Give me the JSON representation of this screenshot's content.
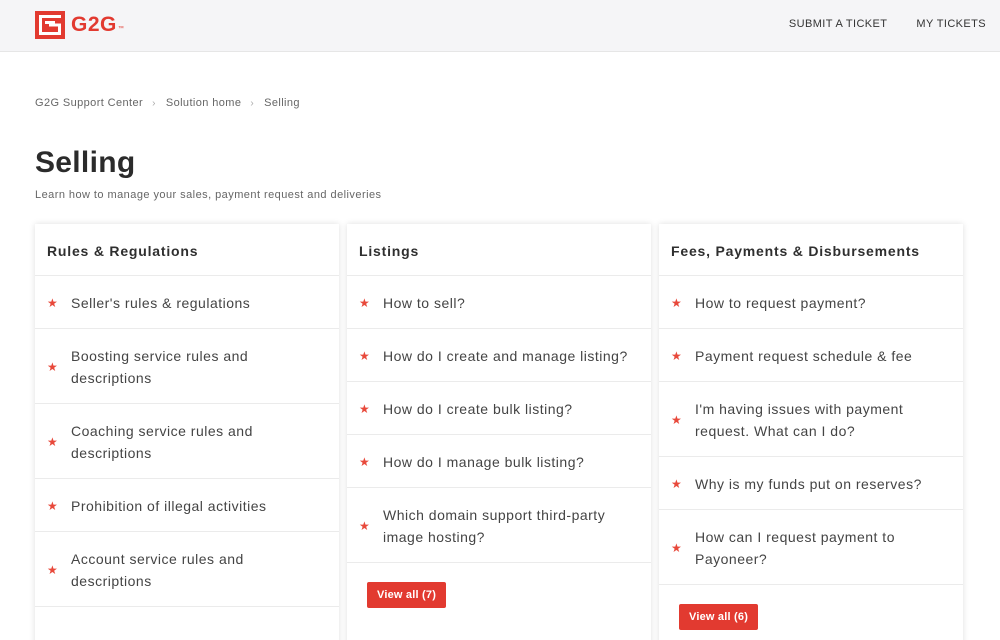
{
  "brand": {
    "name": "G2G",
    "tm": "™",
    "color": "#e23a30"
  },
  "nav": {
    "submit_ticket": "SUBMIT A TICKET",
    "my_tickets": "MY TICKETS"
  },
  "breadcrumb": [
    "G2G Support Center",
    "Solution home",
    "Selling"
  ],
  "page": {
    "title": "Selling",
    "description": "Learn how to manage your sales, payment request and deliveries"
  },
  "sections": [
    {
      "title": "Rules & Regulations",
      "items": [
        "Seller's rules & regulations",
        "Boosting service rules and descriptions",
        "Coaching service rules and descriptions",
        "Prohibition of illegal activities",
        "Account service rules and descriptions"
      ],
      "view_all": ""
    },
    {
      "title": "Listings",
      "items": [
        "How to sell?",
        "How do I create and manage listing?",
        "How do I create bulk listing?",
        "How do I manage bulk listing?",
        "Which domain support third-party image hosting?"
      ],
      "view_all": "View all (7)"
    },
    {
      "title": "Fees, Payments & Disbursements",
      "items": [
        "How to request payment?",
        "Payment request schedule & fee",
        "I'm having issues with payment request. What can I do?",
        "Why is my funds put on reserves?",
        "How can I request payment to Payoneer?"
      ],
      "view_all": "View all (6)"
    }
  ],
  "icons": {
    "logo": "g2g-logo-icon",
    "article": "star-icon",
    "breadcrumb_separator": "chevron-right-icon"
  },
  "glyphs": {
    "star": "★",
    "chevron": "›"
  }
}
